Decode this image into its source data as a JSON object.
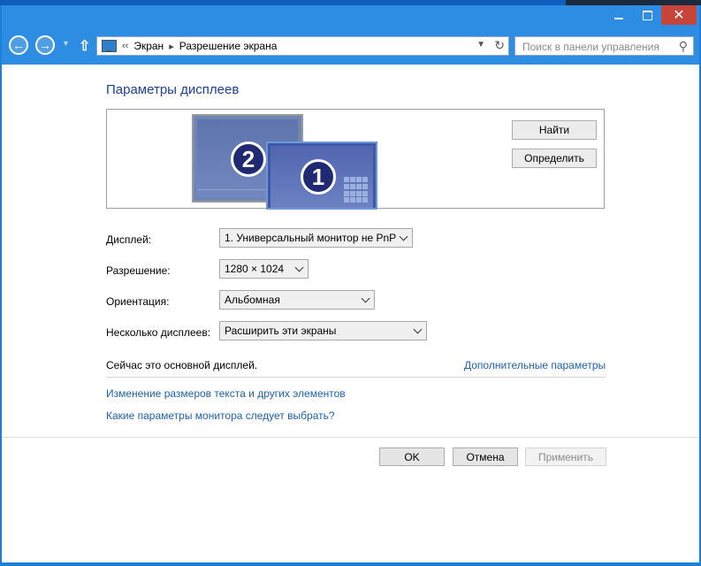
{
  "window": {
    "controls": {
      "minimize": "minimize-icon",
      "maximize": "maximize-icon",
      "close": "close-icon"
    },
    "colors": {
      "frame": "#2c8de3",
      "close": "#c7443a",
      "link": "#1c62b8",
      "heading": "#1e3f9a"
    }
  },
  "addressbar": {
    "back_icon": "arrow-left-icon",
    "forward_icon": "arrow-right-icon",
    "up_icon": "arrow-up-icon",
    "overflow": "‹‹",
    "crumbs": [
      "Экран",
      "Разрешение экрана"
    ],
    "search_placeholder": "Поиск в панели управления"
  },
  "main": {
    "heading": "Параметры дисплеев",
    "preview": {
      "monitors": [
        {
          "number": "2"
        },
        {
          "number": "1"
        }
      ],
      "find_button": "Найти",
      "identify_button": "Определить"
    },
    "display": {
      "label": "Дисплей:",
      "value": "1. Универсальный монитор не PnP"
    },
    "resolution": {
      "label": "Разрешение:",
      "value": "1280 × 1024"
    },
    "orientation": {
      "label": "Ориентация:",
      "value": "Альбомная"
    },
    "multiple": {
      "label": "Несколько дисплеев:",
      "value": "Расширить эти экраны"
    },
    "status": "Сейчас это основной дисплей.",
    "advanced_link": "Дополнительные параметры",
    "text_size_link": "Изменение размеров текста и других элементов",
    "monitor_help_link": "Какие параметры монитора следует выбрать?"
  },
  "dialog_buttons": {
    "ok": "OK",
    "cancel": "Отмена",
    "apply": "Применить"
  }
}
